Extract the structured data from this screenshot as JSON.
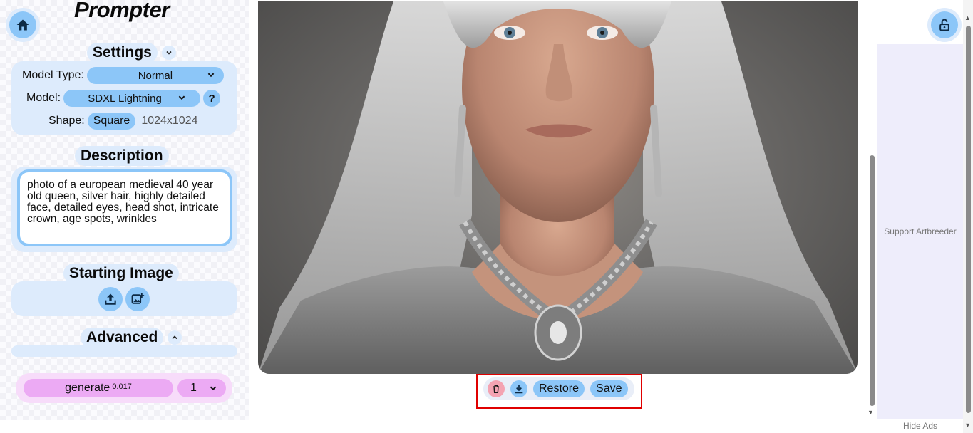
{
  "app": {
    "title": "Prompter"
  },
  "settings": {
    "heading": "Settings",
    "model_type_label": "Model Type:",
    "model_type_value": "Normal",
    "model_label": "Model:",
    "model_value": "SDXL Lightning",
    "help_label": "?",
    "shape_label": "Shape:",
    "shape_value": "Square",
    "dimensions": "1024x1024"
  },
  "description": {
    "heading": "Description",
    "text": "photo of a european medieval 40 year old queen, silver hair, highly detailed face, detailed eyes, head shot, intricate crown, age spots, wrinkles"
  },
  "starting_image": {
    "heading": "Starting Image"
  },
  "advanced": {
    "heading": "Advanced"
  },
  "generate": {
    "label": "generate",
    "cost": "0.017",
    "count": "1"
  },
  "image_toolbar": {
    "restore_label": "Restore",
    "save_label": "Save"
  },
  "ads": {
    "support_text": "Support Artbreeder",
    "hide_label": "Hide Ads"
  },
  "colors": {
    "accent_blue": "#8cc6f8",
    "panel_blue": "#ddebfc",
    "generate_pink": "#ecaaf4",
    "highlight_red": "#e00000"
  }
}
